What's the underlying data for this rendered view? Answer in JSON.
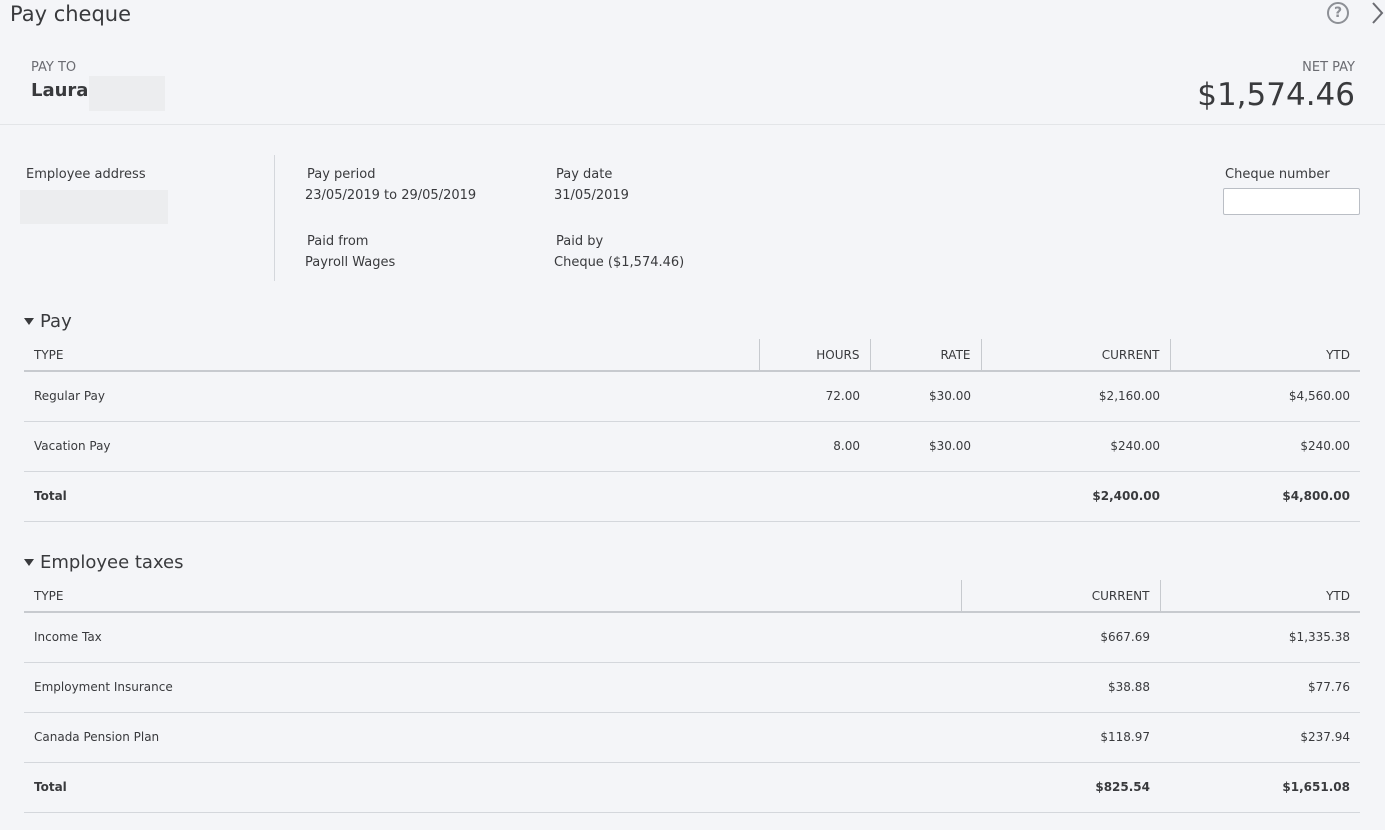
{
  "header": {
    "title": "Pay cheque",
    "help_icon": "?"
  },
  "payto": {
    "label": "PAY TO",
    "name": "Laura"
  },
  "netpay": {
    "label": "NET PAY",
    "value": "$1,574.46"
  },
  "details": {
    "address_label": "Employee address",
    "pay_period_label": "Pay period",
    "pay_period_value": "23/05/2019 to 29/05/2019",
    "pay_date_label": "Pay date",
    "pay_date_value": "31/05/2019",
    "paid_from_label": "Paid from",
    "paid_from_value": "Payroll Wages",
    "paid_by_label": "Paid by",
    "paid_by_value": "Cheque ($1,574.46)",
    "cheque_number_label": "Cheque number",
    "cheque_number_value": ""
  },
  "pay": {
    "title": "Pay",
    "headers": [
      "TYPE",
      "HOURS",
      "RATE",
      "CURRENT",
      "YTD"
    ],
    "rows": [
      [
        "Regular Pay",
        "72.00",
        "$30.00",
        "$2,160.00",
        "$4,560.00"
      ],
      [
        "Vacation Pay",
        "8.00",
        "$30.00",
        "$240.00",
        "$240.00"
      ]
    ],
    "total": [
      "Total",
      "",
      "",
      "$2,400.00",
      "$4,800.00"
    ]
  },
  "taxes": {
    "title": "Employee taxes",
    "headers": [
      "TYPE",
      "CURRENT",
      "YTD"
    ],
    "rows": [
      [
        "Income Tax",
        "$667.69",
        "$1,335.38"
      ],
      [
        "Employment Insurance",
        "$38.88",
        "$77.76"
      ],
      [
        "Canada Pension Plan",
        "$118.97",
        "$237.94"
      ]
    ],
    "total": [
      "Total",
      "$825.54",
      "$1,651.08"
    ]
  }
}
